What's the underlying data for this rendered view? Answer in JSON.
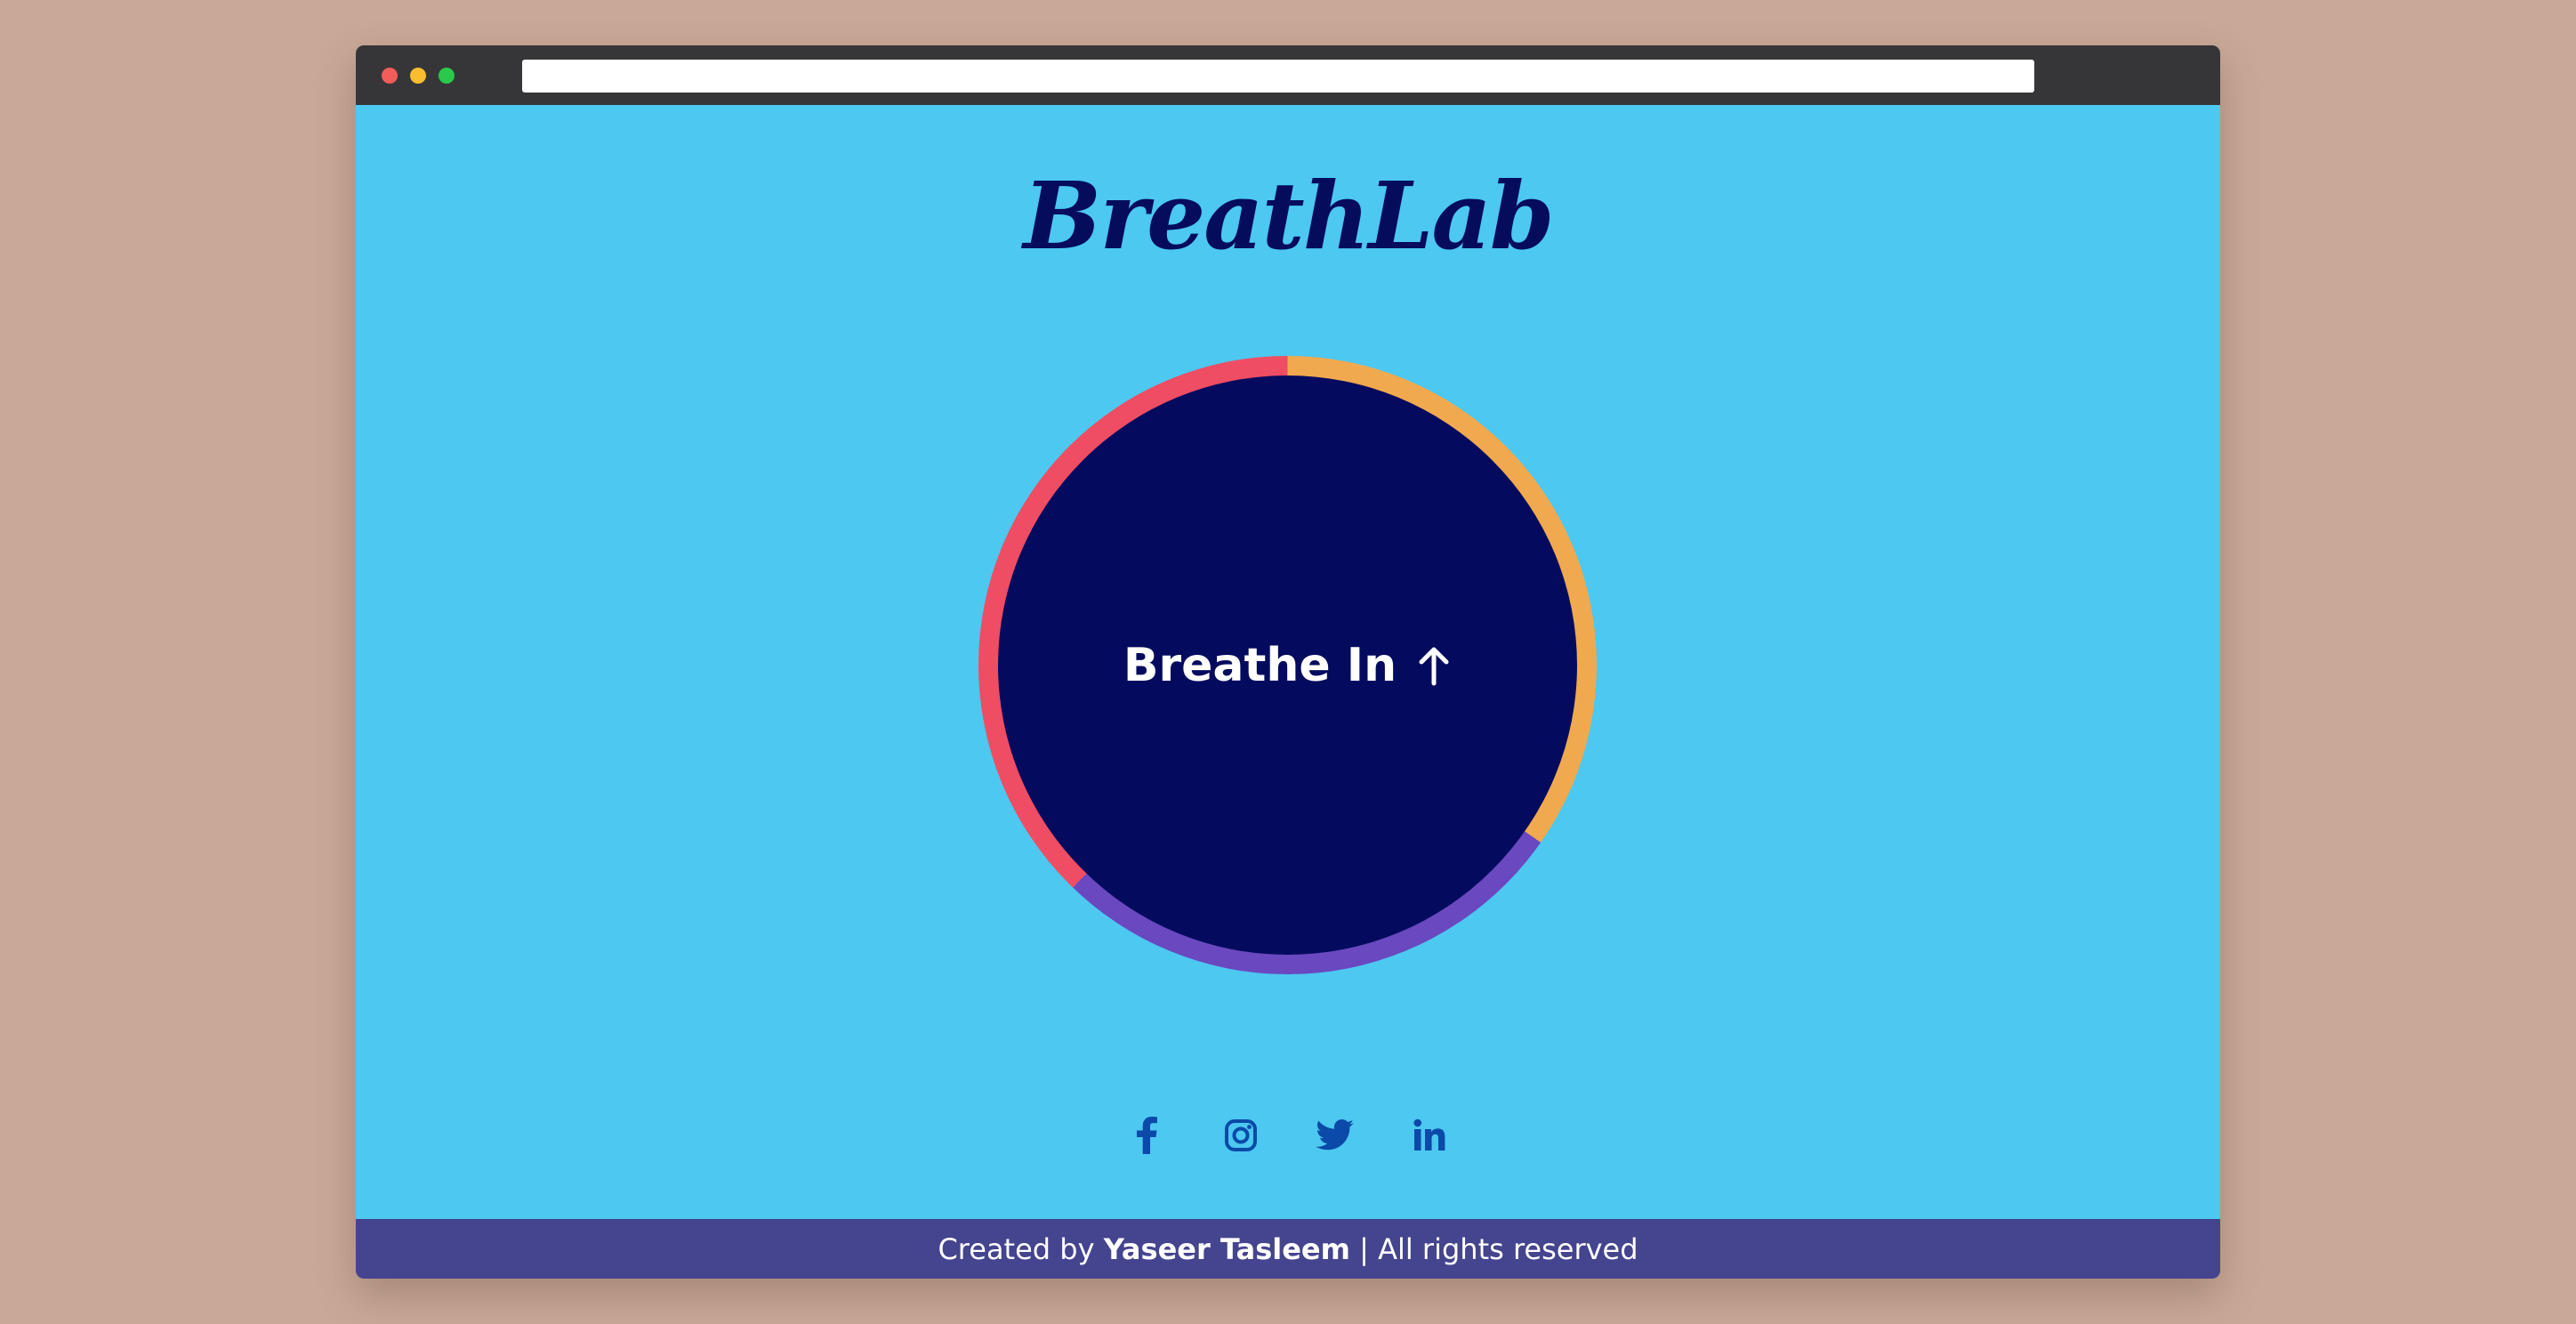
{
  "app": {
    "title": "BreathLab"
  },
  "breathing": {
    "instruction": "Breathe In",
    "direction_icon": "arrow-up-icon",
    "ring_colors": [
      "#f0a94f",
      "#6a48bf",
      "#ef4d63"
    ],
    "circle_color": "#040b5e"
  },
  "social": {
    "icons": [
      "facebook-icon",
      "instagram-icon",
      "twitter-icon",
      "linkedin-icon"
    ],
    "icon_color": "#0b4aa8"
  },
  "footer": {
    "prefix": "Created by",
    "author": "Yaseer Tasleem",
    "suffix": "| All rights reserved"
  },
  "colors": {
    "background": "#4cc8f1",
    "title": "#050c5c",
    "footer": "#45448f"
  }
}
